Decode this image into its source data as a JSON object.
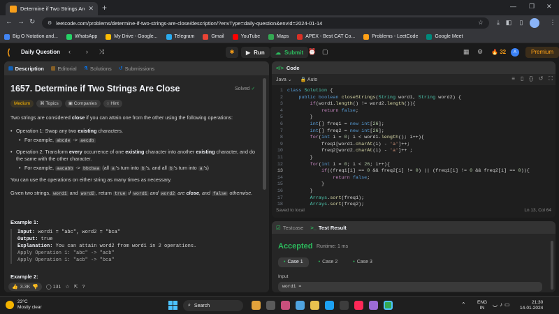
{
  "browser": {
    "tab_title": "Determine if Two Strings Are Cl...",
    "url": "leetcode.com/problems/determine-if-two-strings-are-close/description/?envType=daily-question&envId=2024-01-14",
    "bookmarks": [
      {
        "label": "Big O Notation and...",
        "color": "#4285f4"
      },
      {
        "label": "WhatsApp",
        "color": "#25d366"
      },
      {
        "label": "My Drive - Google...",
        "color": "#fbbc04"
      },
      {
        "label": "Telegram",
        "color": "#2aabee"
      },
      {
        "label": "Gmail",
        "color": "#ea4335"
      },
      {
        "label": "YouTube",
        "color": "#ff0000"
      },
      {
        "label": "Maps",
        "color": "#34a853"
      },
      {
        "label": "APEX - Best CAT Co...",
        "color": "#d93025"
      },
      {
        "label": "Problems - LeetCode",
        "color": "#ffa116"
      },
      {
        "label": "Google Meet",
        "color": "#00897b"
      }
    ]
  },
  "leetcode_header": {
    "daily_label": "Daily Question",
    "run_label": "Run",
    "submit_label": "Submit",
    "streak": "32",
    "avatar_letter": "A",
    "premium_label": "Premium"
  },
  "left_panel": {
    "tabs": [
      "Description",
      "Editorial",
      "Solutions",
      "Submissions"
    ],
    "title": "1657. Determine if Two Strings Are Close",
    "status": "Solved",
    "badges": [
      "Medium",
      "Topics",
      "Companies",
      "Hint"
    ],
    "desc": {
      "p1_a": "Two strings are considered ",
      "p1_b": "close",
      "p1_c": " if you can attain one from the other using the following operations:",
      "op1_a": "Operation 1: Swap any two ",
      "op1_b": "existing",
      "op1_c": " characters.",
      "op1_ex_a": "For example, ",
      "op1_ex_code1": "abcde",
      "op1_ex_arrow": " -> ",
      "op1_ex_code2": "aecdb",
      "op2_a": "Operation 2: Transform ",
      "op2_b": "every",
      "op2_c": " occurrence of one ",
      "op2_d": "existing",
      "op2_e": " character into another ",
      "op2_f": "existing",
      "op2_g": " character, and do the same with the other character.",
      "op2_ex_a": "For example, ",
      "op2_ex_code1": "aacabb",
      "op2_ex_arrow": " -> ",
      "op2_ex_code2": "bbcbaa",
      "op2_ex_b": " (all ",
      "op2_ex_code3": "a",
      "op2_ex_c": "'s turn into ",
      "op2_ex_code4": "b",
      "op2_ex_d": "'s, and all ",
      "op2_ex_code5": "b",
      "op2_ex_e": "'s turn into ",
      "op2_ex_code6": "a",
      "op2_ex_f": "'s)",
      "p2": "You can use the operations on either string as many times as necessary.",
      "p3_a": "Given two strings, ",
      "p3_code1": "word1",
      "p3_b": " and ",
      "p3_code2": "word2",
      "p3_c": ", return ",
      "p3_code3": "true",
      "p3_d": " if ",
      "p3_code4": "word1",
      "p3_e": " and ",
      "p3_code5": "word2",
      "p3_f": " are ",
      "p3_g": "close",
      "p3_h": ", and ",
      "p3_code6": "false",
      "p3_i": " otherwise."
    },
    "example1_title": "Example 1:",
    "example1": {
      "input_label": "Input:",
      "input_value": " word1 = \"abc\", word2 = \"bca\"",
      "output_label": "Output:",
      "output_value": " true",
      "explanation_label": "Explanation:",
      "explanation_value": " You can attain word2 from word1 in 2 operations.",
      "line1": "Apply Operation 1: \"abc\" -> \"acb\"",
      "line2": "Apply Operation 1: \"acb\" -> \"bca\""
    },
    "example2_title": "Example 2:",
    "footer": {
      "likes": "3.3K",
      "comments": "131"
    }
  },
  "code_panel": {
    "title": "Code",
    "language": "Java",
    "mode": "Auto",
    "save_status": "Saved to local",
    "cursor": "Ln 13, Col 64",
    "lines": [
      "class Solution {",
      "    public boolean closeStrings(String word1, String word2) {",
      "        if(word1.length() != word2.length()){",
      "            return false;",
      "        }",
      "        int[] freq1 = new int[26];",
      "        int[] freq2 = new int[26];",
      "        for(int i = 0; i < word1.length(); i++){",
      "            freq1[word1.charAt(i) - 'a']++;",
      "            freq2[word2.charAt(i) - 'a']++ ;",
      "        }",
      "        for(int i = 0; i < 26; i++){",
      "            if((freq1[i] == 0 && freq2[i] != 0) || (freq1[i] != 0 && freq2[i] == 0)){",
      "                return false;",
      "            }",
      "        }",
      "        Arrays.sort(freq1);",
      "        Arrays.sort(freq2);"
    ]
  },
  "test_panel": {
    "tabs": [
      "Testcase",
      "Test Result"
    ],
    "status": "Accepted",
    "runtime": "Runtime: 1 ms",
    "cases": [
      "Case 1",
      "Case 2",
      "Case 3"
    ],
    "input_label": "Input",
    "input_value": "word1 ="
  },
  "taskbar": {
    "temp": "23°C",
    "weather": "Mostly clear",
    "search": "Search",
    "lang1": "ENG",
    "lang2": "IN",
    "time": "21:30",
    "date": "14-01-2024"
  }
}
